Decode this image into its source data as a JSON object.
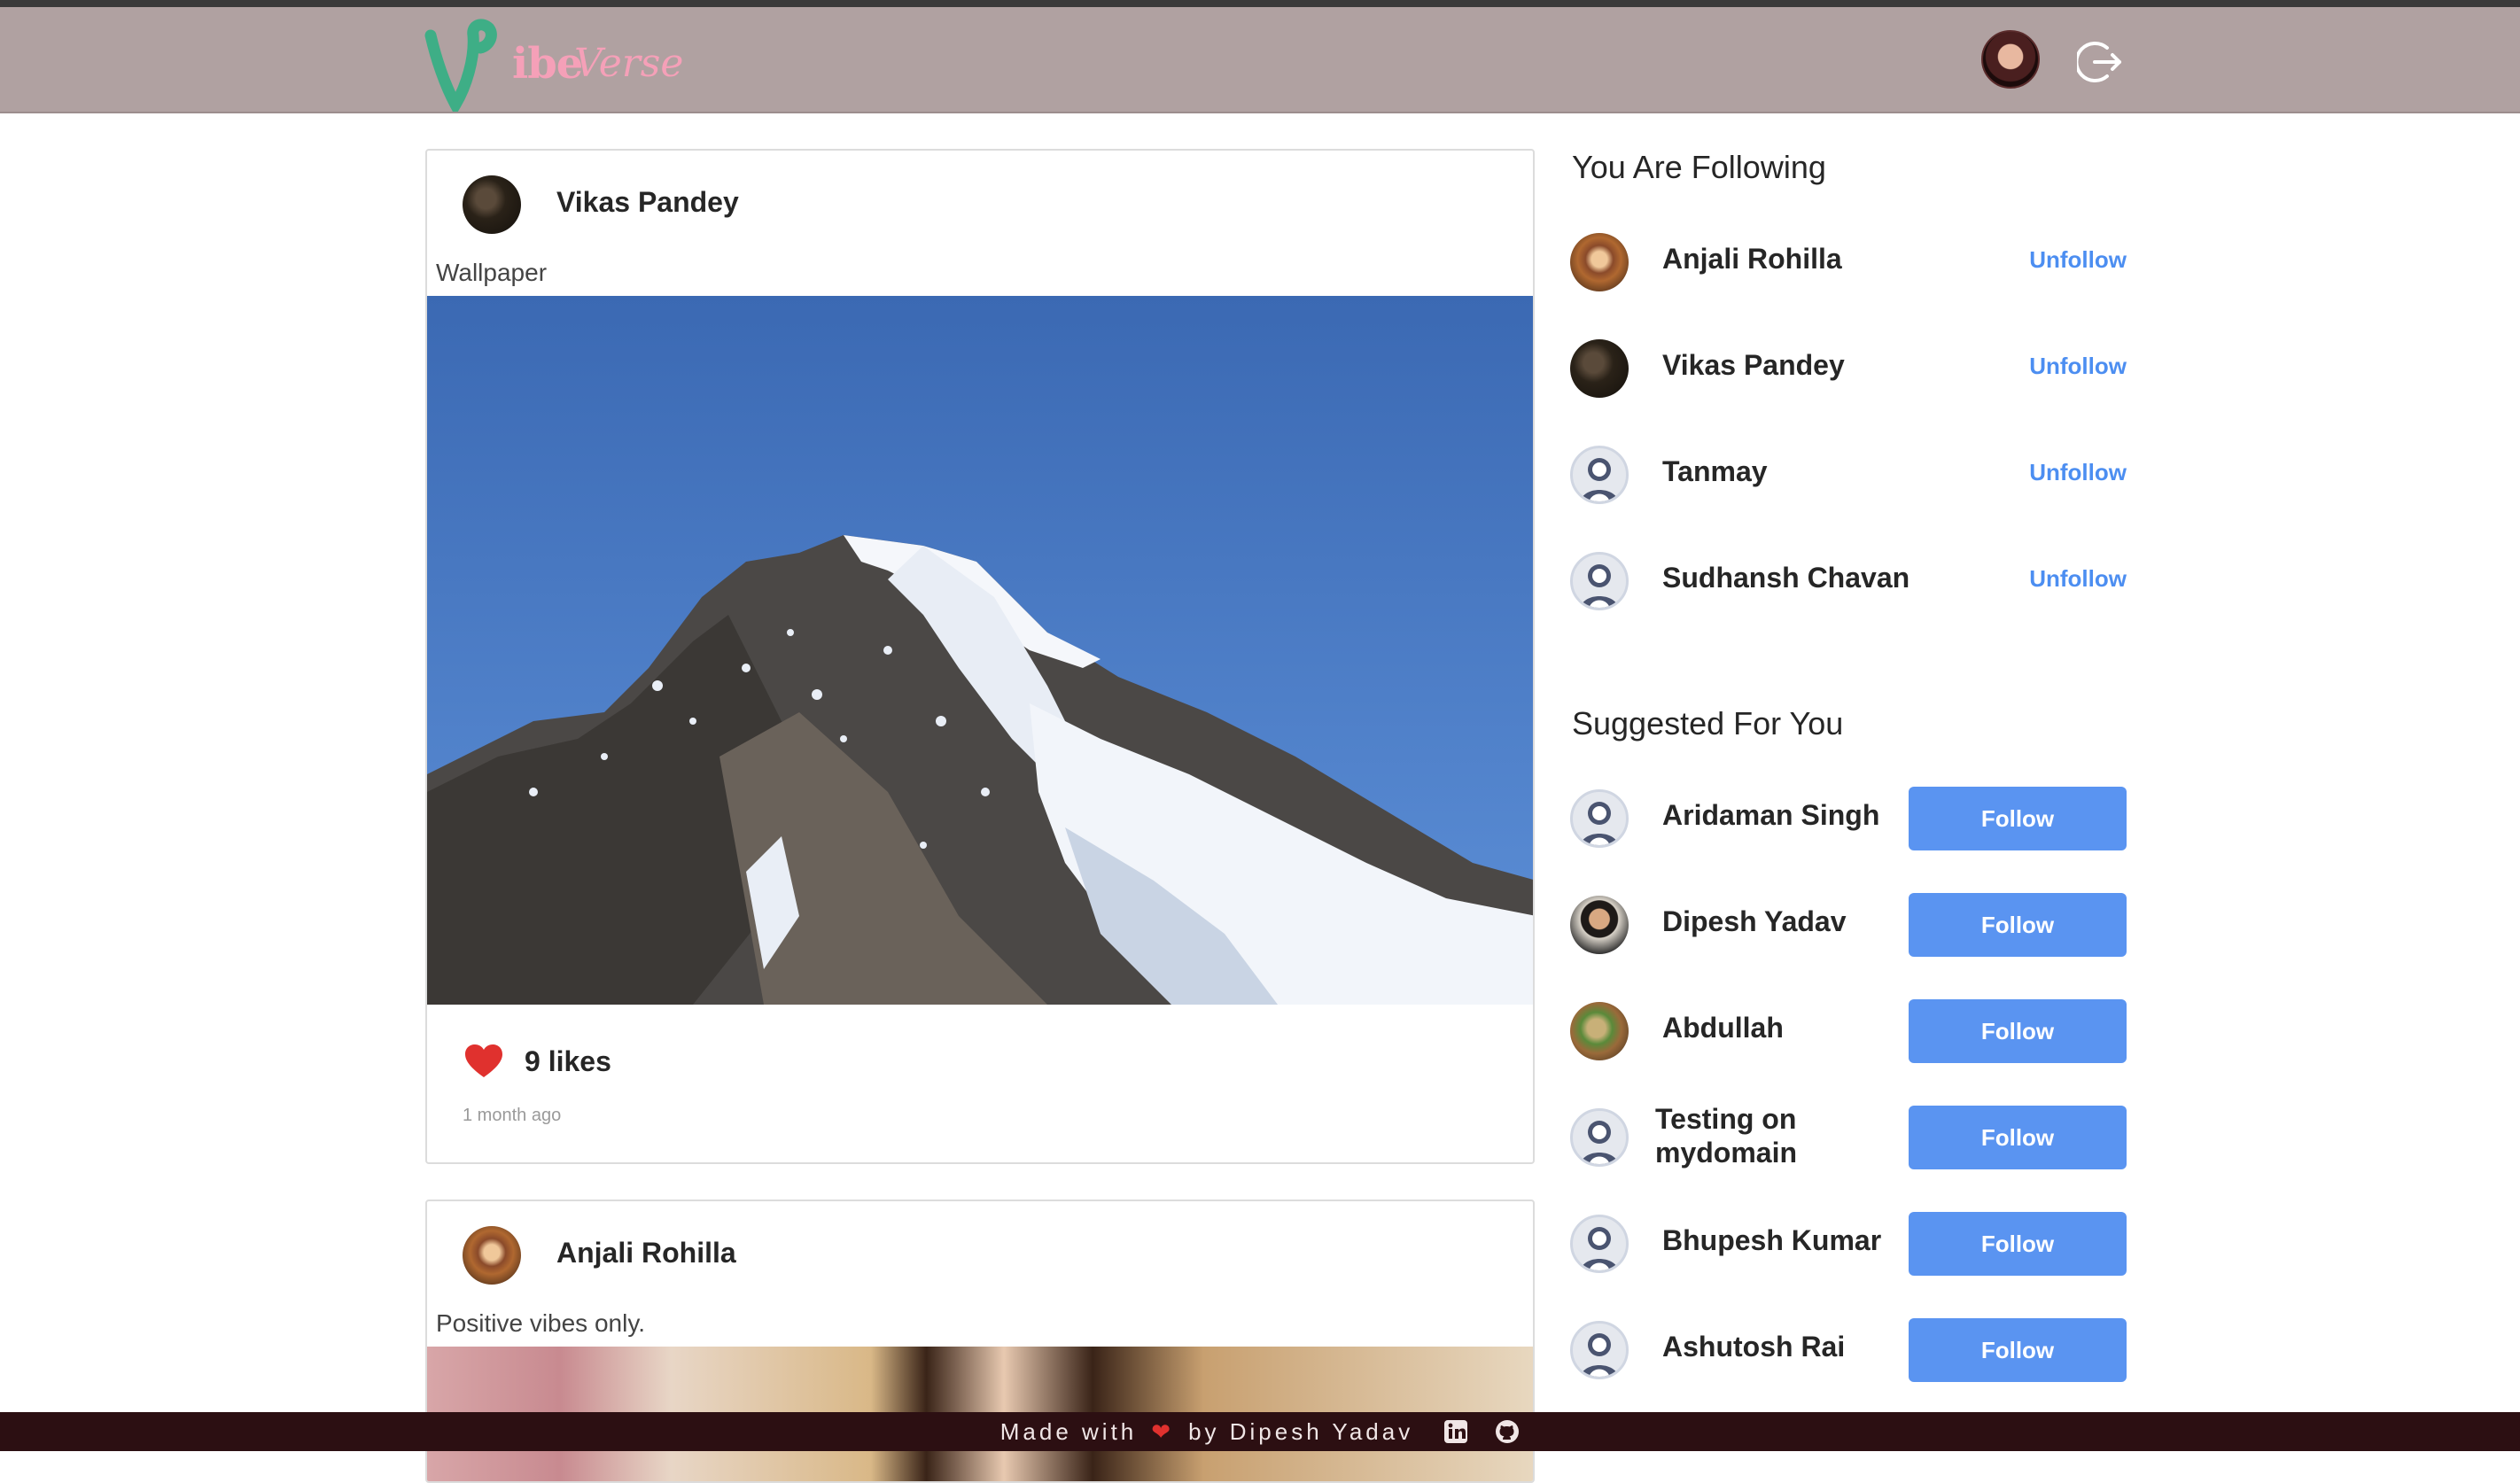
{
  "brand": {
    "name_part1": "ibe",
    "name_part2": "Verse",
    "color": "#f5a0b8",
    "logo_color": "#3eae86"
  },
  "navbar": {
    "background": "#b0a1a1",
    "avatar_icon": "user-avatar",
    "logout_icon": "logout-icon"
  },
  "posts": [
    {
      "author": "Vikas Pandey",
      "caption": "Wallpaper",
      "image": "snow-mountain-photo",
      "likes_text": "9 likes",
      "time": "1 month ago",
      "liked": true
    },
    {
      "author": "Anjali Rohilla",
      "caption": "Positive vibes only.",
      "image": "portrait-photo"
    }
  ],
  "following": {
    "title": "You Are Following",
    "action_label": "Unfollow",
    "users": [
      {
        "name": "Anjali Rohilla",
        "avatar": "photo"
      },
      {
        "name": "Vikas Pandey",
        "avatar": "photo"
      },
      {
        "name": "Tanmay",
        "avatar": "default"
      },
      {
        "name": "Sudhansh Chavan",
        "avatar": "default"
      }
    ]
  },
  "suggested": {
    "title": "Suggested For You",
    "action_label": "Follow",
    "users": [
      {
        "name": "Aridaman Singh",
        "avatar": "default"
      },
      {
        "name": "Dipesh Yadav",
        "avatar": "photo"
      },
      {
        "name": "Abdullah",
        "avatar": "photo"
      },
      {
        "name": "Testing on mydomain",
        "avatar": "default"
      },
      {
        "name": "Bhupesh Kumar",
        "avatar": "default"
      },
      {
        "name": "Ashutosh Rai",
        "avatar": "default"
      }
    ]
  },
  "footer": {
    "made_with": "Made with",
    "by": "by Dipesh Yadav",
    "icons": [
      "linkedin-icon",
      "github-icon"
    ]
  },
  "colors": {
    "accent": "#5a94f1",
    "unfollow": "#4c8ef1",
    "heart": "#e0312e",
    "footer_bg": "#2c0f12"
  }
}
